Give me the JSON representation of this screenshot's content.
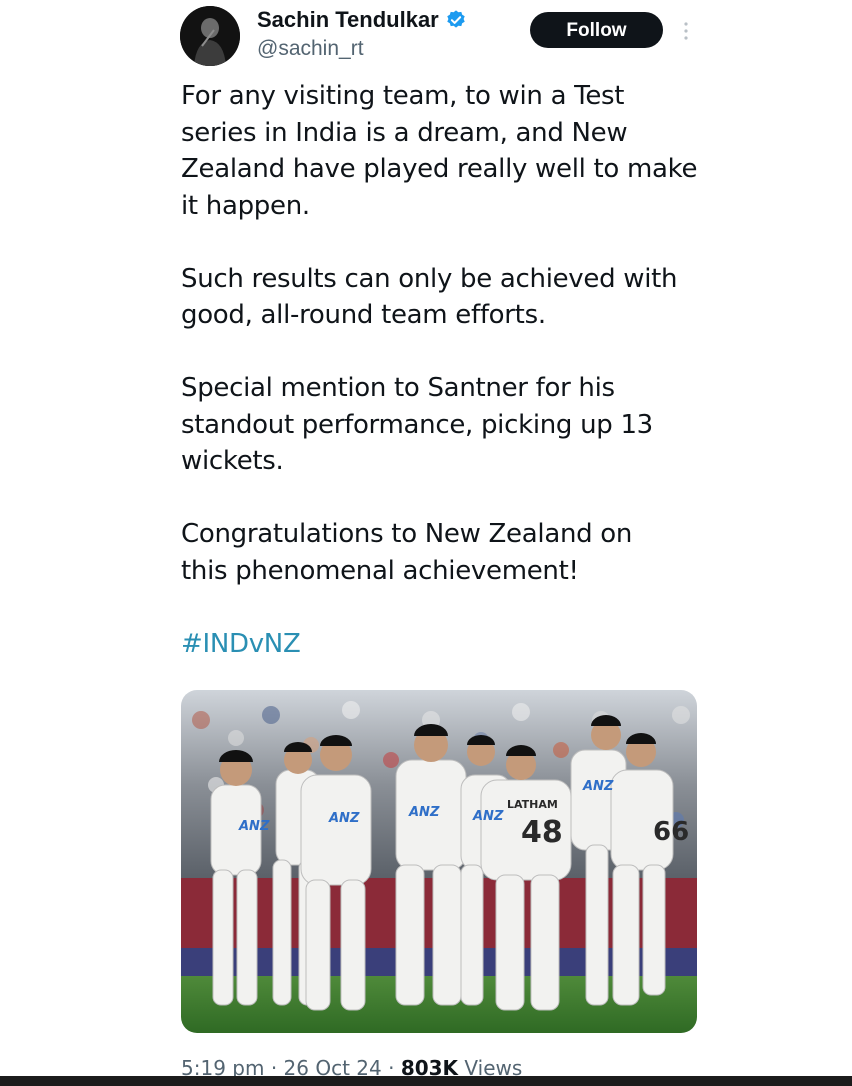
{
  "author": {
    "name": "Sachin Tendulkar",
    "handle": "@sachin_rt",
    "verified_icon": "verified-badge-icon",
    "verified_color": "#1d9bf0"
  },
  "actions": {
    "follow_label": "Follow",
    "more_icon": "more-vertical-icon"
  },
  "tweet": {
    "paragraphs": [
      "For any visiting team, to win a Test\nseries in India is a dream, and New\nZealand have played really well to make\nit happen.",
      "Such results can only be achieved with\ngood, all-round team efforts.",
      "Special mention to Santner for his\nstandout performance, picking up 13\nwickets.",
      "Congratulations to New Zealand on\nthis phenomenal achievement!"
    ],
    "hashtag": "#INDvNZ",
    "hashtag_color": "#2a8fb3"
  },
  "media": {
    "jersey_texts": [
      "LATHAM",
      "48",
      "ANZ",
      "ANZ",
      "ANZ",
      "ANZ",
      "66",
      "ANZ"
    ]
  },
  "meta": {
    "time": "5:19 pm",
    "separator": "·",
    "date": "26 Oct 24",
    "views_count": "803K",
    "views_label": "Views"
  }
}
